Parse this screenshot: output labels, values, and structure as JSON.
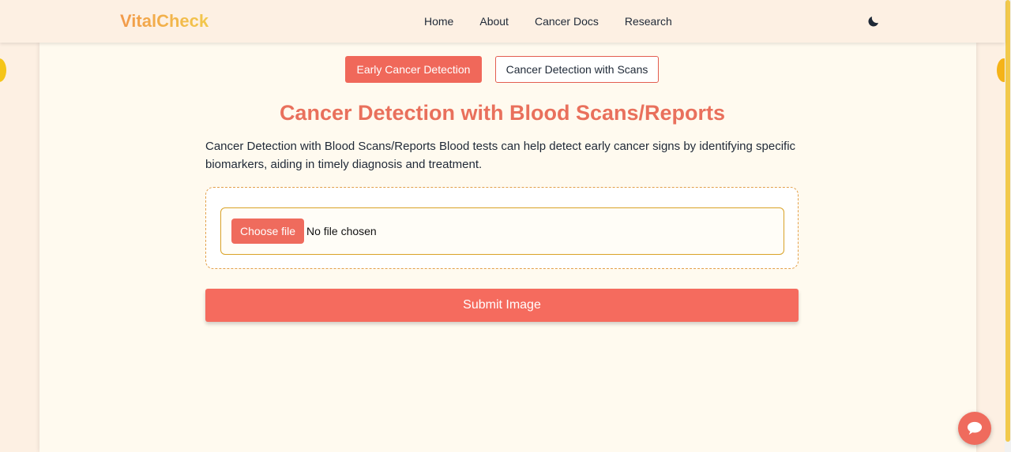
{
  "navbar": {
    "brand": "VitalCheck",
    "links": [
      "Home",
      "About",
      "Cancer Docs",
      "Research"
    ],
    "theme_icon": "moon-icon"
  },
  "tabs": {
    "active_label": "Early Cancer Detection",
    "inactive_label": "Cancer Detection with Scans"
  },
  "main": {
    "title": "Cancer Detection with Blood Scans/Reports",
    "description": "Cancer Detection with Blood Scans/Reports Blood tests can help detect early cancer signs by identifying specific biomarkers, aiding in timely diagnosis and treatment."
  },
  "upload": {
    "choose_label": "Choose file",
    "status": "No file chosen"
  },
  "submit_label": "Submit Image",
  "chat_icon": "chat-bubble-icon",
  "colors": {
    "accent": "#f0685a",
    "title": "#e9705c",
    "brand_gradient_start": "#f2994a",
    "brand_gradient_end": "#f2c94c",
    "background": "#fdf0e3",
    "card": "#fffaef"
  }
}
